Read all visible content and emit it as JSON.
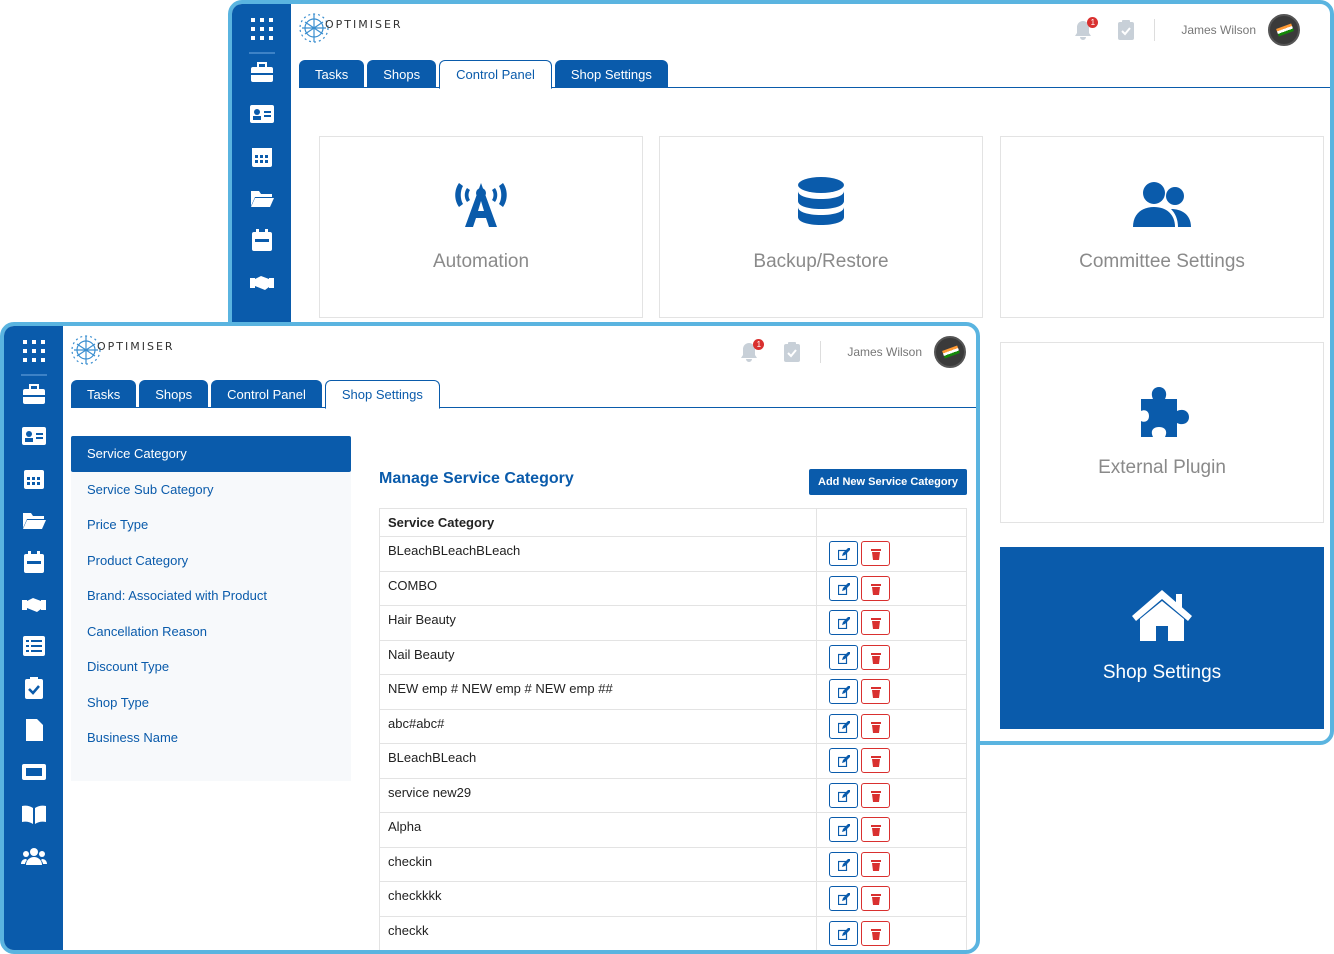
{
  "back_window": {
    "logo_text": "OPTIMISER",
    "user_name": "James Wilson",
    "notification_count": "1",
    "tabs": [
      {
        "label": "Tasks",
        "active": false
      },
      {
        "label": "Shops",
        "active": false
      },
      {
        "label": "Control Panel",
        "active": true
      },
      {
        "label": "Shop Settings",
        "active": false
      }
    ],
    "cards": [
      {
        "label": "Automation",
        "icon": "antenna-icon"
      },
      {
        "label": "Backup/Restore",
        "icon": "database-icon"
      },
      {
        "label": "Committee Settings",
        "icon": "users-icon"
      },
      {
        "label": "External Plugin",
        "icon": "puzzle-icon"
      },
      {
        "label": "Shop Settings",
        "icon": "home-icon",
        "active": true
      }
    ]
  },
  "front_window": {
    "logo_text": "OPTIMISER",
    "user_name": "James Wilson",
    "notification_count": "1",
    "tabs": [
      {
        "label": "Tasks",
        "active": false
      },
      {
        "label": "Shops",
        "active": false
      },
      {
        "label": "Control Panel",
        "active": false
      },
      {
        "label": "Shop Settings",
        "active": true
      }
    ],
    "menu": [
      "Service Category",
      "Service Sub Category",
      "Price Type",
      "Product Category",
      "Brand: Associated with Product",
      "Cancellation Reason",
      "Discount Type",
      "Shop Type",
      "Business Name"
    ],
    "pane_title": "Manage Service Category",
    "add_button": "Add New Service Category",
    "table_header": "Service Category",
    "rows": [
      "BLeachBLeachBLeach",
      "COMBO",
      "Hair Beauty",
      "Nail Beauty",
      "NEW emp # NEW emp # NEW emp ##",
      "abc#abc#",
      "BLeachBLeach",
      "service new29",
      "Alpha",
      "checkin",
      "checkkkk",
      "checkk"
    ]
  },
  "colors": {
    "primary": "#0a5bab",
    "frame": "#5ab4e0",
    "danger": "#d9302f"
  }
}
